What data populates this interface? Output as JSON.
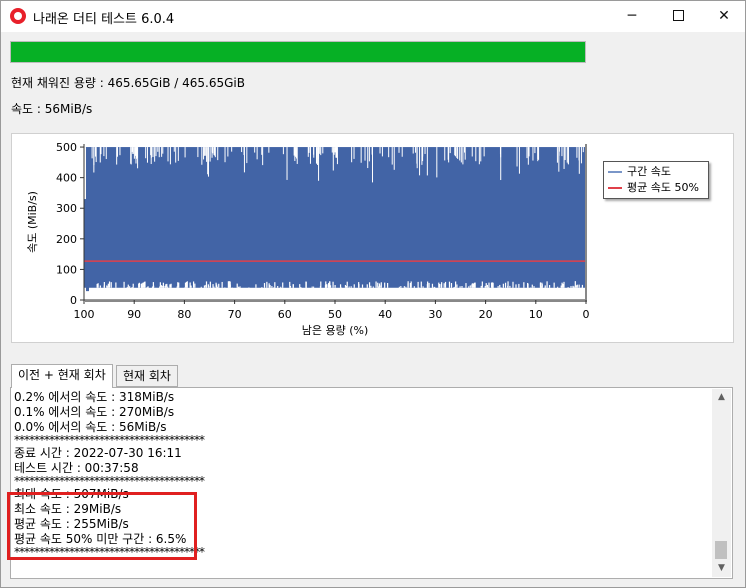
{
  "window": {
    "title": "나래온 더티 테스트 6.0.4",
    "controls": {
      "minimize": "─",
      "close": "✕"
    }
  },
  "progress": {
    "value": 1.0,
    "color": "#06b025"
  },
  "info": {
    "capacity": "현재 채워진 용량 : 465.65GiB / 465.65GiB",
    "speed": "속도 : 56MiB/s"
  },
  "chart_data": {
    "type": "area",
    "x_label": "남은 용량 (%)",
    "y_label": "속도 (MiB/s)",
    "x_ticks": [
      "100",
      "90",
      "80",
      "70",
      "60",
      "50",
      "40",
      "30",
      "20",
      "10",
      "0"
    ],
    "y_ticks": [
      "0",
      "100",
      "200",
      "300",
      "400",
      "500"
    ],
    "xlim": [
      100,
      0
    ],
    "ylim": [
      0,
      510
    ],
    "series": [
      {
        "name": "구간 속도",
        "color": "#4264a6",
        "typical_max": 500,
        "typical_min": 40,
        "start_low": 29,
        "start_high": 330
      },
      {
        "name": "평균 속도 50%",
        "color": "#e0404a",
        "value": 127
      }
    ],
    "legend_position": "right"
  },
  "tabs": [
    {
      "label": "이전 + 현재 회차",
      "active": true
    },
    {
      "label": "현재 회차",
      "active": false
    }
  ],
  "log": {
    "lines": [
      "0.2% 에서의 속도 : 318MiB/s",
      "0.1% 에서의 속도 : 270MiB/s",
      "0.0% 에서의 속도 : 56MiB/s",
      "**************************************",
      "종료 시간 : 2022-07-30 16:11",
      "테스트 시간 : 00:37:58",
      "**************************************",
      "최대 속도 : 507MiB/s",
      "최소 속도 : 29MiB/s",
      "평균 속도 : 255MiB/s",
      "평균 속도 50% 미만 구간 : 6.5%",
      "**************************************"
    ]
  },
  "scrollbar": {
    "up_icon": "▲",
    "down_icon": "▼"
  },
  "highlight_color": "#e02020"
}
